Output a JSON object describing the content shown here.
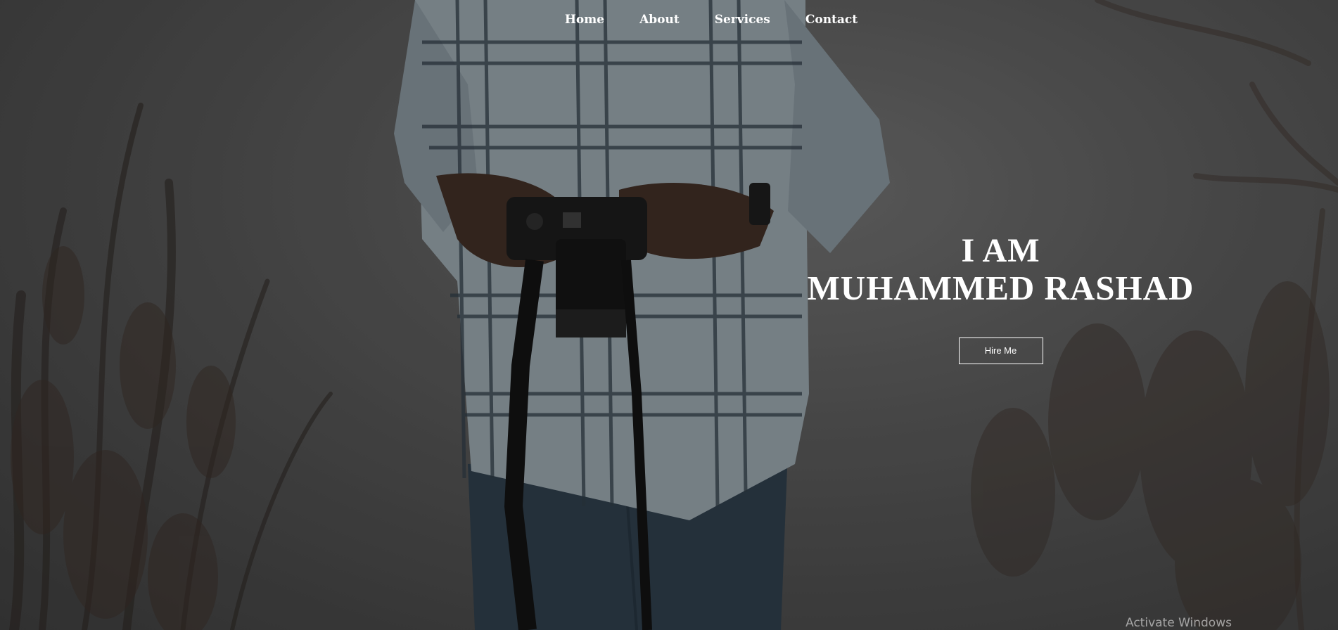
{
  "nav": {
    "items": [
      {
        "label": "Home"
      },
      {
        "label": "About"
      },
      {
        "label": "Services"
      },
      {
        "label": "Contact"
      }
    ]
  },
  "hero": {
    "line1": "I AM",
    "line2": "MUHAMMED RASHAD",
    "button_label": "Hire Me"
  },
  "watermark": "Activate Windows",
  "colors": {
    "text": "#ffffff",
    "background": "#4a4a4a",
    "shirt": "#9aa6ad",
    "jeans": "#2f3f4c"
  }
}
